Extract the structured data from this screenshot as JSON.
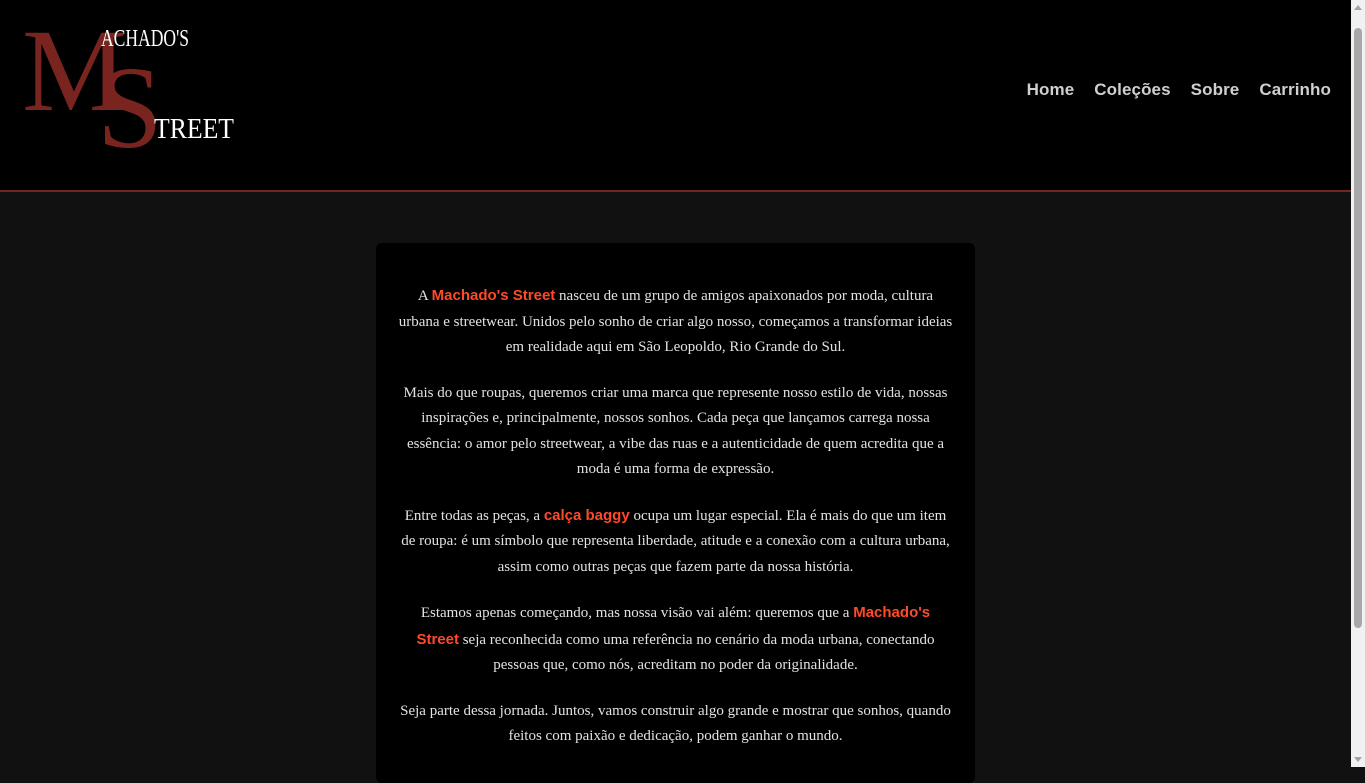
{
  "logo": {
    "big_m": "M",
    "big_s": "S",
    "top_word": "ACHADO'S",
    "bottom_word": "TREET",
    "color_primary": "#7a2420",
    "color_text": "#ffffff"
  },
  "nav": {
    "items": [
      {
        "label": "Home"
      },
      {
        "label": "Coleções"
      },
      {
        "label": "Sobre"
      },
      {
        "label": "Carrinho"
      }
    ]
  },
  "content": {
    "p1": {
      "before": "A ",
      "highlight": "Machado's Street",
      "after": " nasceu de um grupo de amigos apaixonados por moda, cultura urbana e streetwear. Unidos pelo sonho de criar algo nosso, começamos a transformar ideias em realidade aqui em São Leopoldo, Rio Grande do Sul."
    },
    "p2": "Mais do que roupas, queremos criar uma marca que represente nosso estilo de vida, nossas inspirações e, principalmente, nossos sonhos. Cada peça que lançamos carrega nossa essência: o amor pelo streetwear, a vibe das ruas e a autenticidade de quem acredita que a moda é uma forma de expressão.",
    "p3": {
      "before": "Entre todas as peças, a ",
      "highlight": "calça baggy",
      "after": " ocupa um lugar especial. Ela é mais do que um item de roupa: é um símbolo que representa liberdade, atitude e a conexão com a cultura urbana, assim como outras peças que fazem parte da nossa história."
    },
    "p4": {
      "before": "Estamos apenas começando, mas nossa visão vai além: queremos que a ",
      "highlight": "Machado's Street",
      "after": " seja reconhecida como uma referência no cenário da moda urbana, conectando pessoas que, como nós, acreditam no poder da originalidade."
    },
    "p5": "Seja parte dessa jornada. Juntos, vamos construir algo grande e mostrar que sonhos, quando feitos com paixão e dedicação, podem ganhar o mundo.",
    "highlight_color": "#ff4a2a"
  }
}
